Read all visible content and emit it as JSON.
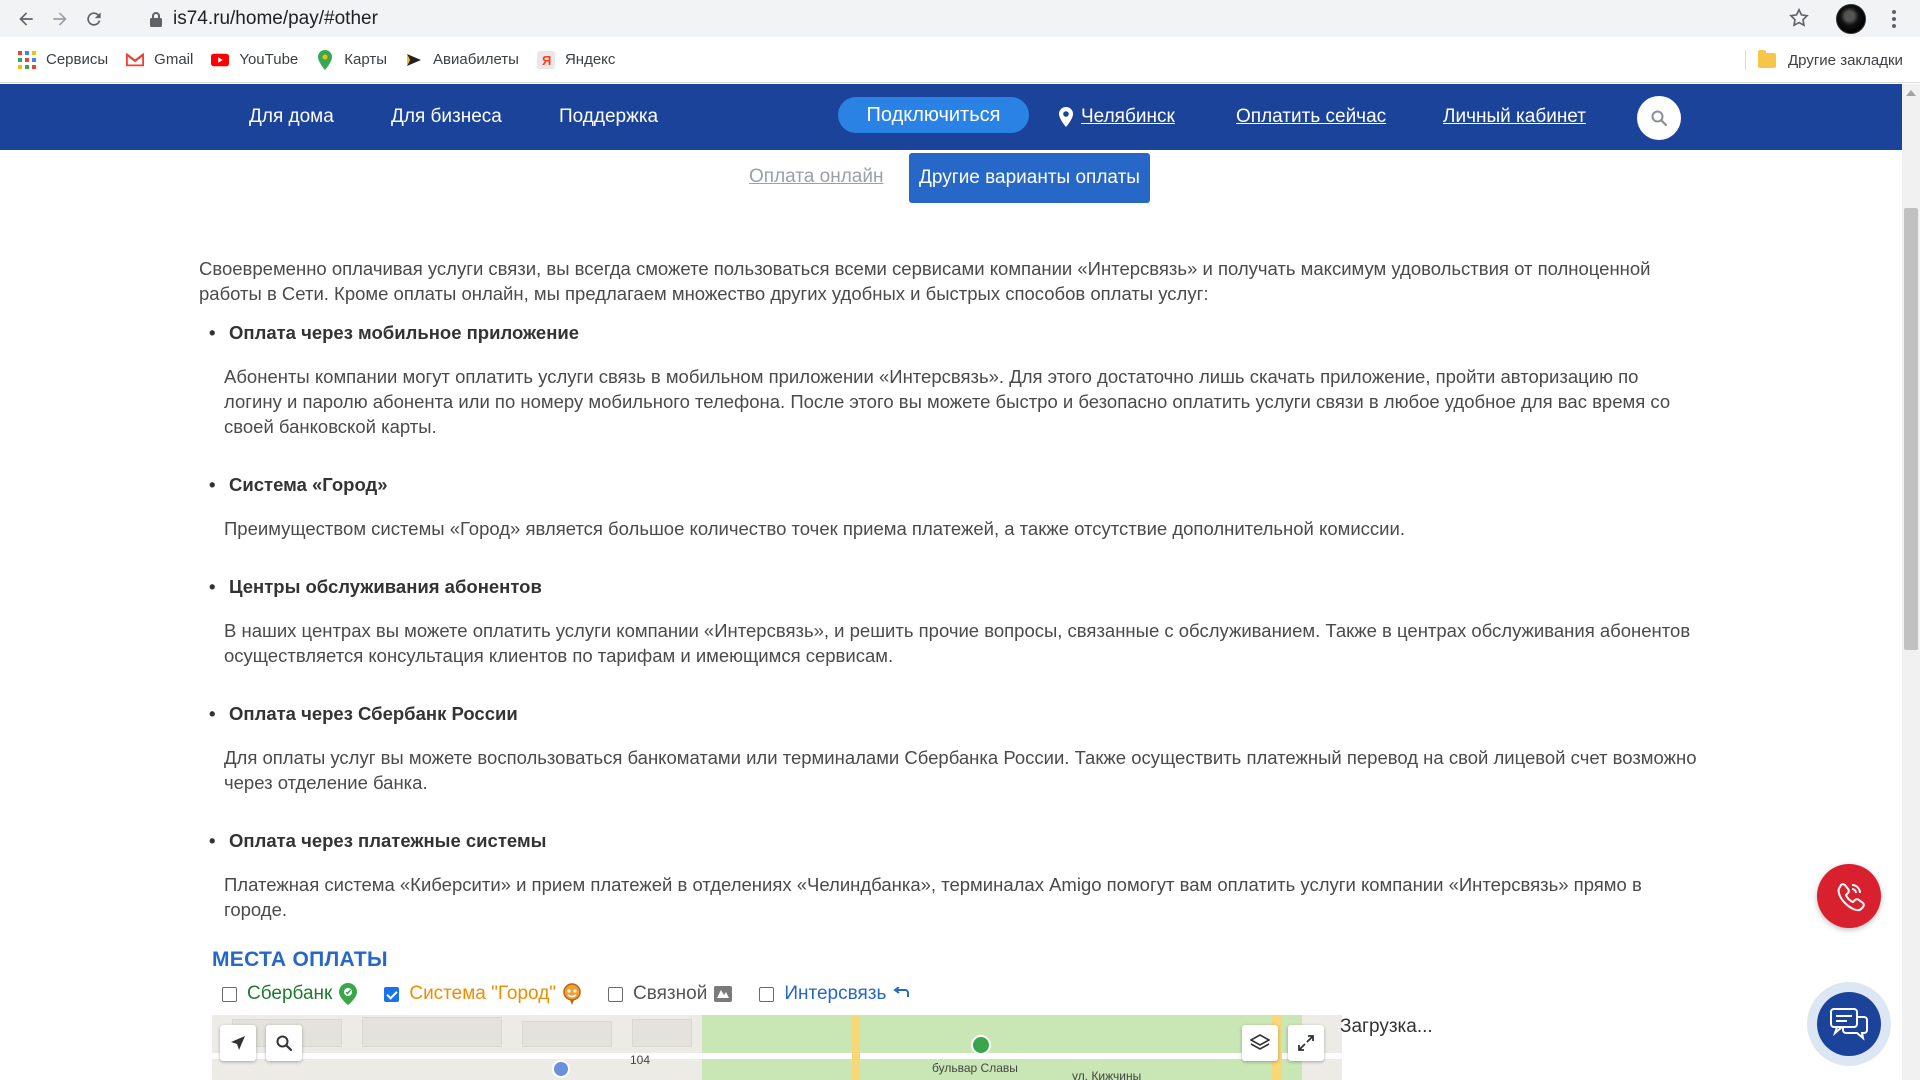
{
  "browser": {
    "url": "is74.ru/home/pay/#other",
    "bookmarks": [
      {
        "label": "Сервисы",
        "icon": "apps-grid-icon"
      },
      {
        "label": "Gmail",
        "icon": "gmail-icon"
      },
      {
        "label": "YouTube",
        "icon": "youtube-icon"
      },
      {
        "label": "Карты",
        "icon": "maps-pin-icon"
      },
      {
        "label": "Авиабилеты",
        "icon": "plane-icon"
      },
      {
        "label": "Яндекс",
        "icon": "yandex-icon"
      }
    ],
    "other_bookmarks": "Другие закладки"
  },
  "header": {
    "nav": [
      "Для дома",
      "Для бизнеса",
      "Поддержка"
    ],
    "connect": "Подключиться",
    "city": "Челябинск",
    "pay_now": "Оплатить сейчас",
    "cabinet": "Личный кабинет",
    "brand_color": "#1b4399"
  },
  "tabs": {
    "online": "Оплата онлайн",
    "other": "Другие варианты оплаты"
  },
  "content": {
    "intro": "Своевременно оплачивая услуги связи, вы всегда сможете пользоваться всеми сервисами компании «Интерсвязь» и получать максимум удовольствия от полноценной работы в Сети. Кроме оплаты онлайн, мы предлагаем множество других удобных и быстрых способов оплаты услуг:",
    "items": [
      {
        "title": "Оплата через мобильное приложение",
        "text": "Абоненты компании могут оплатить услуги связь в мобильном приложении «Интерсвязь». Для этого достаточно лишь скачать приложение, пройти авторизацию по логину и паролю абонента или по номеру мобильного телефона. После этого вы можете быстро и безопасно оплатить услуги связи в любое удобное для вас время со своей банковской карты."
      },
      {
        "title": "Система «Город»",
        "text": "Преимуществом системы «Город» является большое количество точек приема платежей, а также отсутствие дополнительной комиссии."
      },
      {
        "title": "Центры обслуживания абонентов",
        "text": "В наших центрах вы можете оплатить услуги компании «Интерсвязь», и решить прочие вопросы, связанные с обслуживанием. Также в центрах обслуживания абонентов осуществляется консультация клиентов по тарифам и имеющимся сервисам."
      },
      {
        "title": "Оплата через Сбербанк России",
        "text": "Для оплаты услуг вы можете воспользоваться банкоматами или терминалами Сбербанка России. Также осуществить платежный перевод на свой лицевой счет возможно через отделение банка."
      },
      {
        "title": "Оплата через платежные системы",
        "text": "Платежная система «Киберсити» и прием платежей в отделениях «Челиндбанка», терминалах Amigo помогут вам оплатить услуги компании «Интерсвязь» прямо в городе."
      }
    ]
  },
  "places": {
    "title": "МЕСТА ОПЛАТЫ",
    "filters": [
      {
        "label": "Сбербанк",
        "checked": false,
        "color": "#1e7a2e",
        "icon": "sberbank-pin-icon"
      },
      {
        "label": "Система \"Город\"",
        "checked": true,
        "color": "#f08c00",
        "icon": "gorod-pin-icon"
      },
      {
        "label": "Связной",
        "checked": false,
        "color": "#555555",
        "icon": "svyaznoy-icon"
      },
      {
        "label": "Интерсвязь",
        "checked": false,
        "color": "#2767c7",
        "icon": "intersvyaz-arrow-icon"
      }
    ],
    "map_labels": {
      "number": "104",
      "street": "бульвар Славы",
      "street2": "ул. Кижчины"
    },
    "loading": "Загрузка..."
  }
}
